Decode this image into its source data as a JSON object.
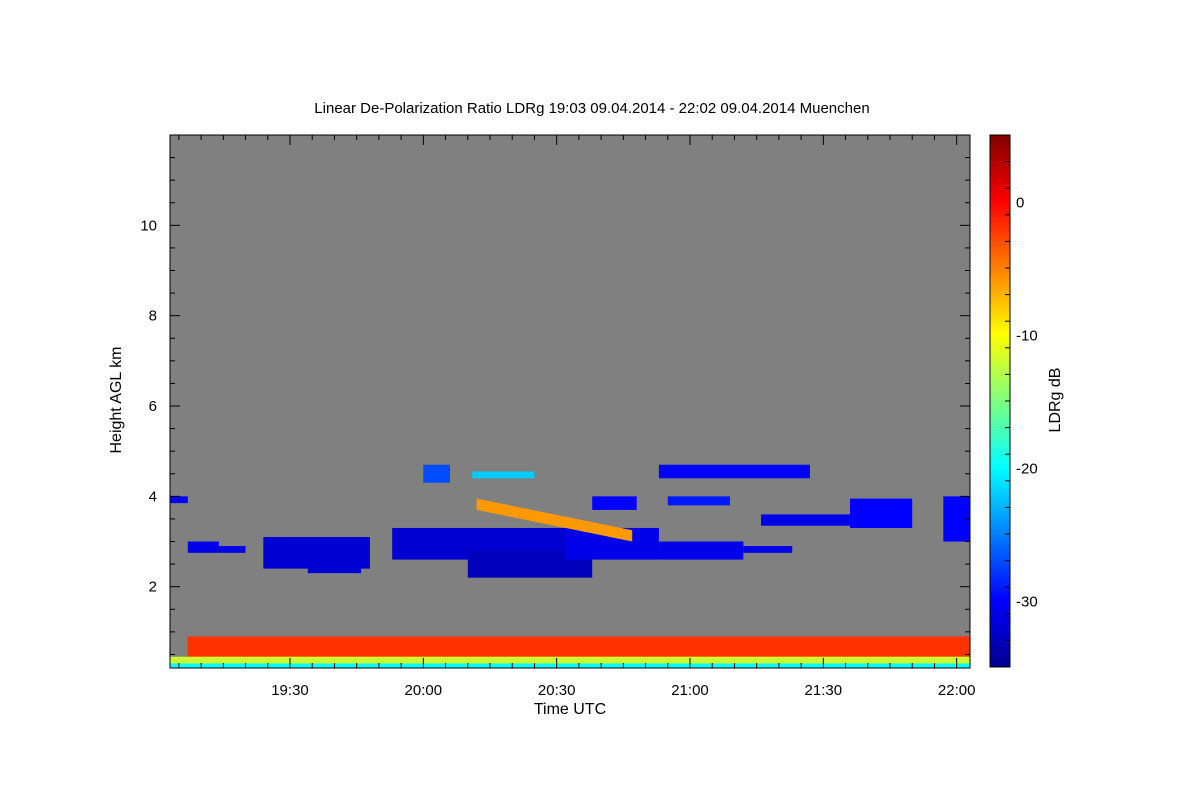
{
  "chart_data": {
    "type": "heatmap",
    "title": "Linear De-Polarization Ratio LDRg   19:03 09.04.2014 - 22:02 09.04.2014 Muenchen",
    "xlabel": "Time UTC",
    "ylabel": "Height AGL km",
    "colorbar_label": "LDRg dB",
    "x_tick_labels": [
      "19:30",
      "20:00",
      "20:30",
      "21:00",
      "21:30",
      "22:00"
    ],
    "x_tick_values_min": [
      1170,
      1200,
      1230,
      1260,
      1290,
      1320
    ],
    "xlim_min": [
      1143,
      1323
    ],
    "y_tick_labels": [
      "2",
      "4",
      "6",
      "8",
      "10"
    ],
    "y_tick_values": [
      2,
      4,
      6,
      8,
      10
    ],
    "ylim": [
      0.2,
      12.0
    ],
    "colorbar_ticks": [
      "0",
      "-10",
      "-20",
      "-30"
    ],
    "colorbar_tick_values": [
      0,
      -10,
      -20,
      -30
    ],
    "clim": [
      -35,
      5
    ],
    "background_color": "#808080",
    "colormap": [
      "#00008f",
      "#0000ff",
      "#0080ff",
      "#00ffff",
      "#80ff80",
      "#ffff00",
      "#ff8000",
      "#ff0000",
      "#800000"
    ],
    "regions": [
      {
        "t": [
          1143,
          1147
        ],
        "h": [
          3.85,
          4.0
        ],
        "ldr": -30
      },
      {
        "t": [
          1147,
          1154
        ],
        "h": [
          2.75,
          3.0
        ],
        "ldr": -31
      },
      {
        "t": [
          1154,
          1160
        ],
        "h": [
          2.75,
          2.9
        ],
        "ldr": -31
      },
      {
        "t": [
          1164,
          1188
        ],
        "h": [
          2.4,
          3.1
        ],
        "ldr": -32
      },
      {
        "t": [
          1174,
          1186
        ],
        "h": [
          2.3,
          2.6
        ],
        "ldr": -32
      },
      {
        "t": [
          1193,
          1232
        ],
        "h": [
          2.6,
          3.3
        ],
        "ldr": -32
      },
      {
        "t": [
          1210,
          1238
        ],
        "h": [
          2.2,
          2.8
        ],
        "ldr": -33
      },
      {
        "t": [
          1232,
          1253
        ],
        "h": [
          2.6,
          3.3
        ],
        "ldr": -31
      },
      {
        "t": [
          1253,
          1272
        ],
        "h": [
          2.6,
          3.0
        ],
        "ldr": -31
      },
      {
        "t": [
          1272,
          1283
        ],
        "h": [
          2.75,
          2.9
        ],
        "ldr": -31
      },
      {
        "t": [
          1200,
          1206
        ],
        "h": [
          4.3,
          4.7
        ],
        "ldr": -27
      },
      {
        "t": [
          1211,
          1225
        ],
        "h": [
          4.4,
          4.55
        ],
        "ldr": -22
      },
      {
        "t": [
          1253,
          1287
        ],
        "h": [
          4.4,
          4.7
        ],
        "ldr": -30
      },
      {
        "t": [
          1238,
          1248
        ],
        "h": [
          3.7,
          4.0
        ],
        "ldr": -30
      },
      {
        "t": [
          1255,
          1269
        ],
        "h": [
          3.8,
          4.0
        ],
        "ldr": -29
      },
      {
        "t": [
          1276,
          1296
        ],
        "h": [
          3.35,
          3.6
        ],
        "ldr": -31
      },
      {
        "t": [
          1296,
          1310
        ],
        "h": [
          3.3,
          3.95
        ],
        "ldr": -30
      },
      {
        "t": [
          1317,
          1323
        ],
        "h": [
          3.0,
          4.0
        ],
        "ldr": -30
      },
      {
        "t": [
          1147,
          1323
        ],
        "h": [
          0.4,
          0.9
        ],
        "ldr": -2
      },
      {
        "t": [
          1143,
          1323
        ],
        "h": [
          0.3,
          0.45
        ],
        "ldr": -12
      },
      {
        "t": [
          1143,
          1323
        ],
        "h": [
          0.2,
          0.3
        ],
        "ldr": -20
      }
    ],
    "falling_streak": {
      "t": [
        1212,
        1247
      ],
      "h": [
        3.95,
        3.25
      ],
      "ldr": -6
    }
  }
}
